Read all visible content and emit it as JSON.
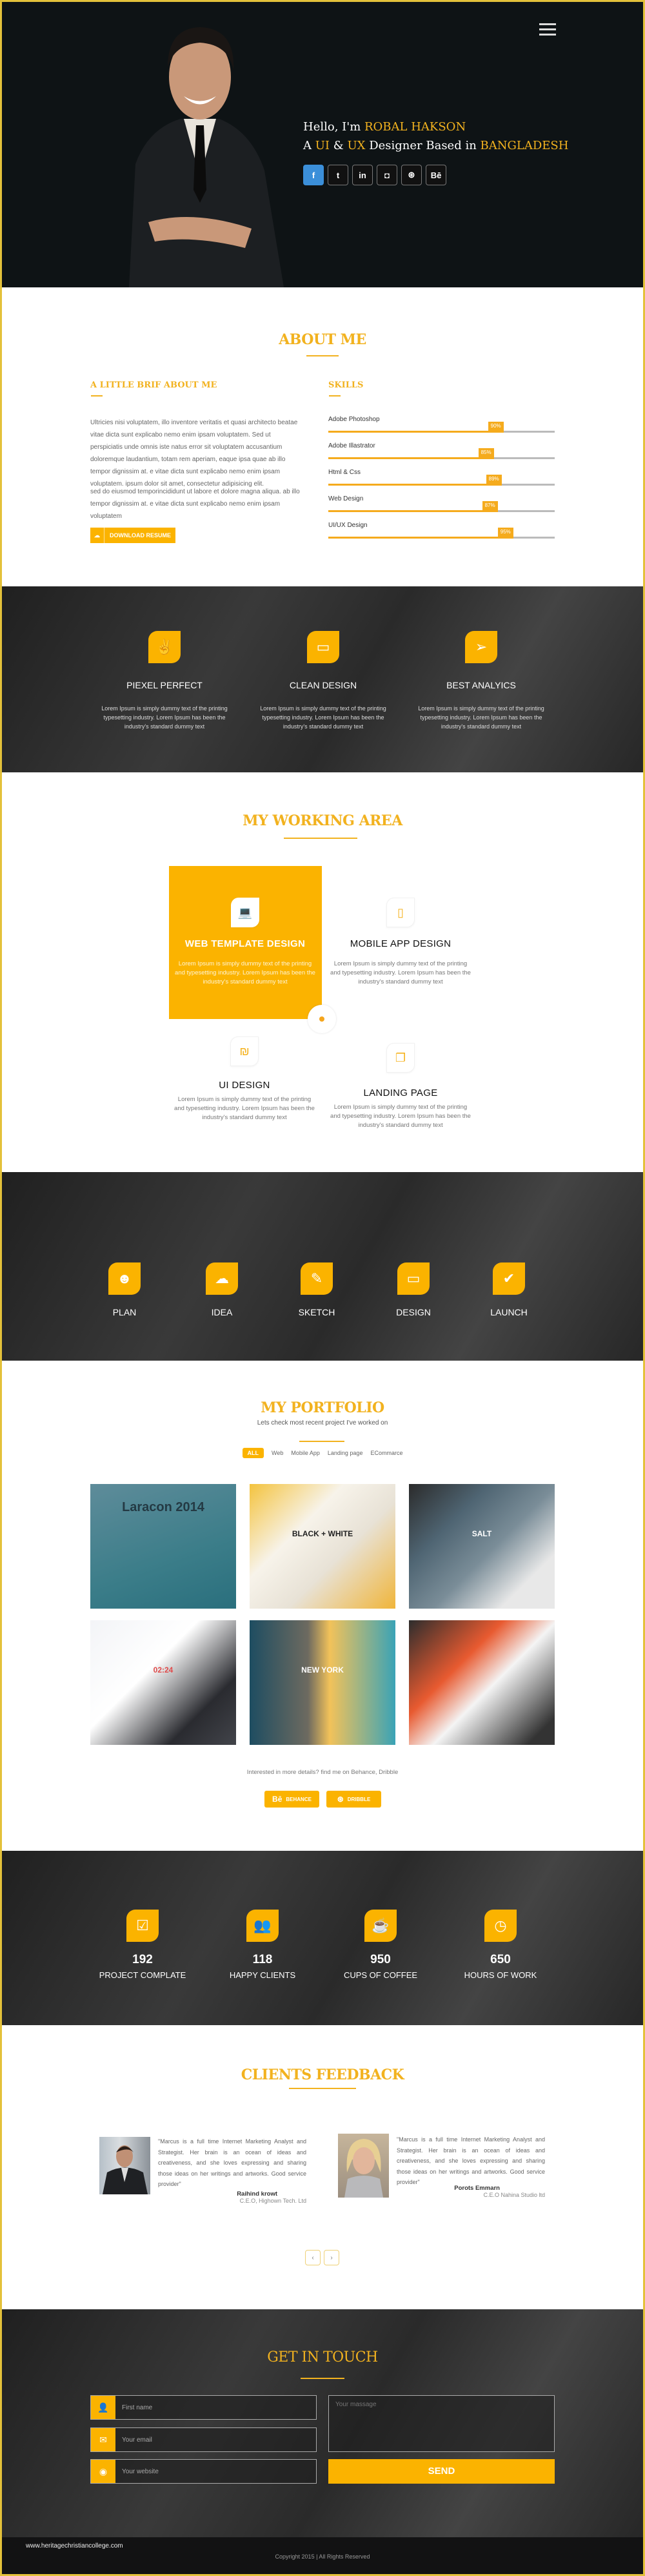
{
  "colors": {
    "accent": "#fbb300",
    "title": "#f2b21f",
    "hero_bg": "#0e1315",
    "dark_section": "#2d2d2d",
    "footer": "#121213",
    "facebook": "#3b8fd9"
  },
  "hero": {
    "menu_icon": "hamburger-icon",
    "line1_prefix": "Hello, I'm ",
    "name": "ROBAL HAKSON",
    "line2_a": "A ",
    "ui": "UI",
    "amp": " & ",
    "ux": "UX",
    "line2_b": " Designer Based in ",
    "country": "BANGLADESH",
    "social": [
      {
        "icon": "facebook-icon",
        "glyph": "f"
      },
      {
        "icon": "twitter-icon",
        "glyph": "t"
      },
      {
        "icon": "linkedin-icon",
        "glyph": "in"
      },
      {
        "icon": "instagram-icon",
        "glyph": "◘"
      },
      {
        "icon": "dribbble-icon",
        "glyph": "⊛"
      },
      {
        "icon": "behance-icon",
        "glyph": "Bē"
      }
    ]
  },
  "about": {
    "title": "ABOUT ME",
    "brief_title": "A LITTLE BRIF ABOUT ME",
    "para1": "Ultricies nisi voluptatem, illo inventore veritatis et quasi architecto beatae vitae dicta sunt explicabo nemo enim ipsam voluptatem. Sed ut perspiciatis unde omnis iste natus error sit voluptatem accusantium doloremque laudantium, totam rem aperiam, eaque ipsa quae ab illo tempor dignissim at. e vitae dicta sunt explicabo nemo enim ipsam voluptatem. ipsum dolor sit amet, consectetur adipisicing elit.",
    "para2": "sed do eiusmod temporincididunt ut labore et dolore magna aliqua. ab illo tempor dignissim at. e vitae dicta sunt explicabo nemo enim ipsam voluptatem",
    "download_label": "DOWNLOAD RESUME",
    "skills_title": "SKILLS",
    "skills": [
      {
        "name": "Adobe Photoshop",
        "percent": 90,
        "label": "90%"
      },
      {
        "name": "Adobe Illastrator",
        "percent": 85,
        "label": "85%"
      },
      {
        "name": "Html & Css",
        "percent": 89,
        "label": "89%"
      },
      {
        "name": "Web Design",
        "percent": 87,
        "label": "87%"
      },
      {
        "name": "UI/UX Design",
        "percent": 95,
        "label": "95%"
      }
    ]
  },
  "features": [
    {
      "icon": "peace-hand-icon",
      "glyph": "✌",
      "title": "PIEXEL PERFECT",
      "text": "Lorem Ipsum is simply dummy text of the printing typesetting industry. Lorem Ipsum has been the industry's standard dummy text"
    },
    {
      "icon": "monitor-icon",
      "glyph": "▭",
      "title": "CLEAN DESIGN",
      "text": "Lorem Ipsum is simply dummy text of the printing typesetting industry. Lorem Ipsum has been the industry's standard dummy text"
    },
    {
      "icon": "paper-plane-icon",
      "glyph": "➢",
      "title": "BEST ANALYICS",
      "text": "Lorem Ipsum is simply dummy text of the printing typesetting industry. Lorem Ipsum has been the industry's standard dummy text"
    }
  ],
  "working": {
    "title": "MY WORKING AREA",
    "items": [
      {
        "icon": "laptop-icon",
        "glyph": "💻",
        "title": "WEB TEMPLATE DESIGN",
        "text": "Lorem Ipsum is simply dummy text of the printing and typesetting industry. Lorem Ipsum has been the industry's standard dummy text"
      },
      {
        "icon": "mobile-icon",
        "glyph": "▯",
        "title": "MOBILE APP DESIGN",
        "text": "Lorem Ipsum is simply dummy text of the printing and typesetting industry. Lorem Ipsum has been the industry's standard dummy text"
      },
      {
        "icon": "ui-design-icon",
        "glyph": "₪",
        "title": "UI DESIGN",
        "text": "Lorem Ipsum is simply dummy text of the printing and typesetting industry. Lorem Ipsum has been the industry's standard dummy text"
      },
      {
        "icon": "pages-icon",
        "glyph": "❐",
        "title": "LANDING PAGE",
        "text": "Lorem Ipsum is simply dummy text of the printing and typesetting industry. Lorem Ipsum has been the industry's standard dummy text"
      }
    ]
  },
  "process": [
    {
      "icon": "github-icon",
      "glyph": "☻",
      "label": "PLAN"
    },
    {
      "icon": "cloud-icon",
      "glyph": "☁",
      "label": "IDEA"
    },
    {
      "icon": "pencil-square-icon",
      "glyph": "✎",
      "label": "SKETCH"
    },
    {
      "icon": "desktop-icon",
      "glyph": "▭",
      "label": "DESIGN"
    },
    {
      "icon": "check-icon",
      "glyph": "✔",
      "label": "LAUNCH"
    }
  ],
  "portfolio": {
    "title": "MY PORTFOLIO",
    "subtitle": "Lets check most recent project I've worked on",
    "filters": [
      "ALL",
      "Web",
      "Mobile App",
      "Landing page",
      "ECommarce"
    ],
    "active_filter": "ALL",
    "thumb_texts": [
      "Laracon 2014",
      "BLACK + WHITE",
      "SALT",
      "02:24",
      "NEW YORK",
      ""
    ],
    "more_text": "Interested in more details? find me on Behance, Dribble",
    "behance_label": "BEHANCE",
    "dribbble_label": "DRIBBLE"
  },
  "stats": [
    {
      "icon": "checkbox-icon",
      "glyph": "☑",
      "value": "192",
      "label": "PROJECT COMPLATE"
    },
    {
      "icon": "users-icon",
      "glyph": "👥",
      "value": "118",
      "label": "HAPPY CLIENTS"
    },
    {
      "icon": "coffee-icon",
      "glyph": "☕",
      "value": "950",
      "label": "CUPS OF COFFEE"
    },
    {
      "icon": "clock-icon",
      "glyph": "◷",
      "value": "650",
      "label": "HOURS OF WORK"
    }
  ],
  "clients": {
    "title": "CLIENTS FEEDBACK",
    "items": [
      {
        "quote": "\"Marcus is a full time Internet Marketing Analyst and Strategist. Her brain is an ocean of ideas and creativeness, and she loves expressing and sharing those ideas on her writings and artworks. Good service provider\"",
        "name": "Raihind krowt",
        "role": "C.E.O,  Highown Tech. Ltd"
      },
      {
        "quote": "\"Marcus is a full time Internet Marketing Analyst and Strategist. Her brain is an ocean of ideas and creativeness, and she loves expressing and sharing those ideas on her writings and artworks. Good service provider\"",
        "name": "Porots Emmarn",
        "role": "C.E.O Nahina Studio ltd"
      }
    ],
    "prev": "‹",
    "next": "›"
  },
  "contact": {
    "title": "GET IN TOUCH",
    "first_name_placeholder": "First name",
    "email_placeholder": "Your email",
    "website_placeholder": "Your website",
    "message_placeholder": "Your massage",
    "send_label": "SEND"
  },
  "footer": {
    "website": "www.heritagechristiancollege.com",
    "copyright": "Copyright 2015   | All Rights Reserved"
  }
}
